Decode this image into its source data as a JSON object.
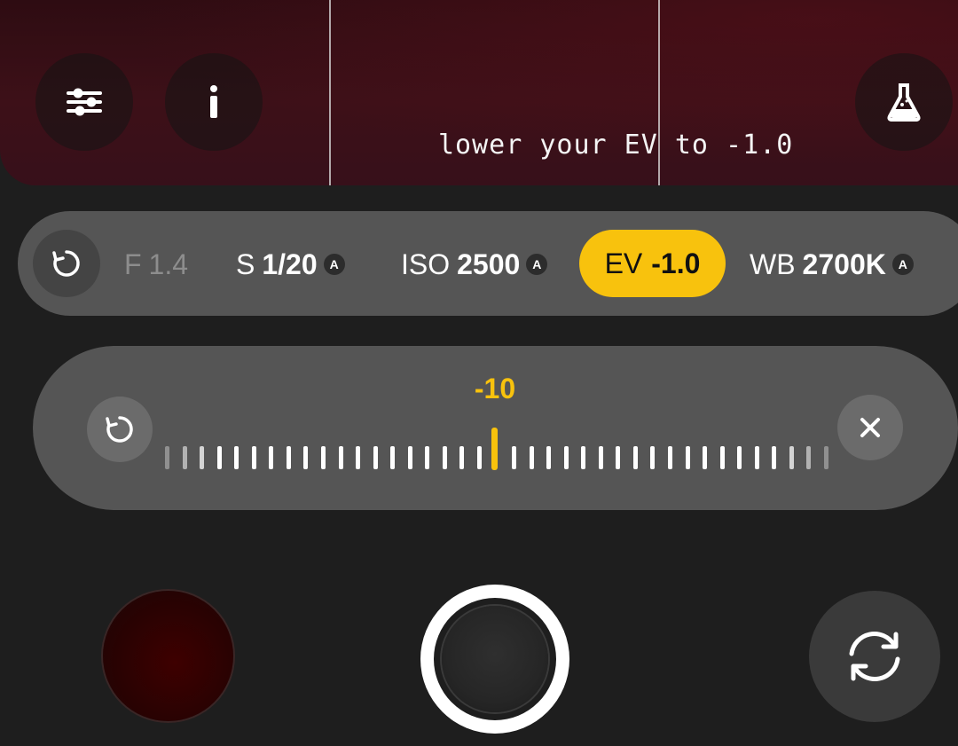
{
  "viewfinder": {
    "hint_text": "lower your EV to -1.0",
    "buttons": {
      "settings_icon": "sliders-icon",
      "info_icon": "info-icon",
      "lab_icon": "flask-icon"
    }
  },
  "params": {
    "reset_icon": "reset-icon",
    "aperture": {
      "label": "F",
      "value": "1.4",
      "enabled": false
    },
    "shutter": {
      "label": "S",
      "value": "1/20",
      "badge": "A"
    },
    "iso": {
      "label": "ISO",
      "value": "2500",
      "badge": "A"
    },
    "ev": {
      "label": "EV",
      "value": "-1.0",
      "selected": true
    },
    "wb": {
      "label": "WB",
      "value": "2700K",
      "badge": "A"
    }
  },
  "slider": {
    "value_label": "-10",
    "reset_icon": "reset-icon",
    "close_icon": "close-icon",
    "accent_color": "#f8c20d"
  },
  "bottom": {
    "gallery": "gallery-thumbnail",
    "shutter": "shutter-button",
    "flip_icon": "switch-camera-icon"
  },
  "colors": {
    "accent": "#f8c20d",
    "panel": "#555555",
    "background": "#1e1e1e"
  }
}
